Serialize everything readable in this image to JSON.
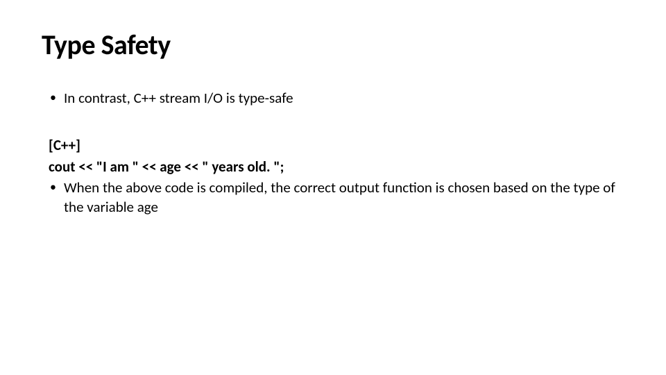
{
  "title": "Type Safety",
  "bullet1": "In contrast, C++ stream I/O is type-safe",
  "code": {
    "label": "[C++]",
    "line": "cout << \"I am \" << age << \" years old. \";"
  },
  "bullet2": "When the above code is compiled, the correct output function is chosen based on the type of the variable age"
}
